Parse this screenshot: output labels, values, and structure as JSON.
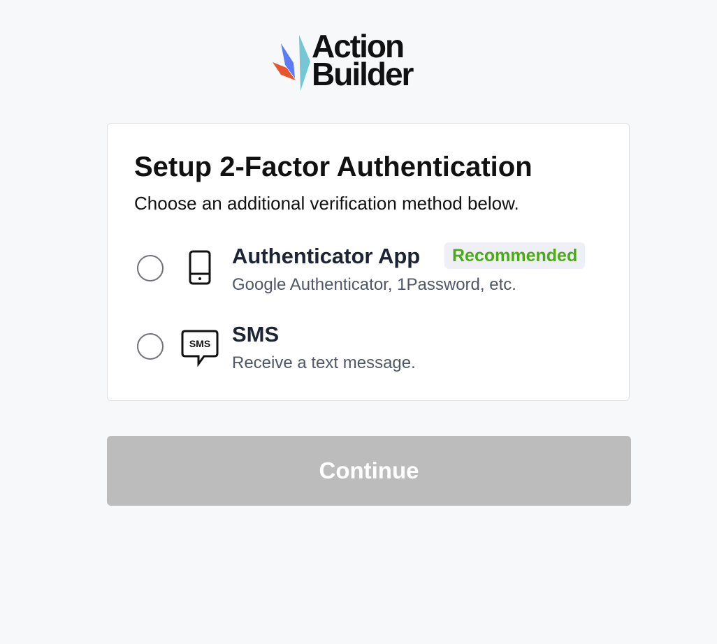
{
  "logo": {
    "line1": "Action",
    "line2": "Builder",
    "colors": {
      "blue": "#5b7cf4",
      "orange": "#e8542c",
      "teal": "#76c6d3"
    }
  },
  "card": {
    "title": "Setup 2-Factor Authentication",
    "subtitle": "Choose an additional verification method below."
  },
  "options": [
    {
      "title": "Authenticator App",
      "badge": "Recommended",
      "description": "Google Authenticator, 1Password, etc.",
      "icon": "smartphone-icon",
      "selected": false
    },
    {
      "title": "SMS",
      "description": "Receive a text message.",
      "icon": "sms-bubble-icon",
      "icon_text": "SMS",
      "selected": false
    }
  ],
  "continue_button": {
    "label": "Continue",
    "disabled": true
  },
  "colors": {
    "page_background": "#f7f8fa",
    "badge_text": "#4caa16",
    "badge_background": "#eef0f5",
    "button_disabled": "#bcbcbc"
  }
}
